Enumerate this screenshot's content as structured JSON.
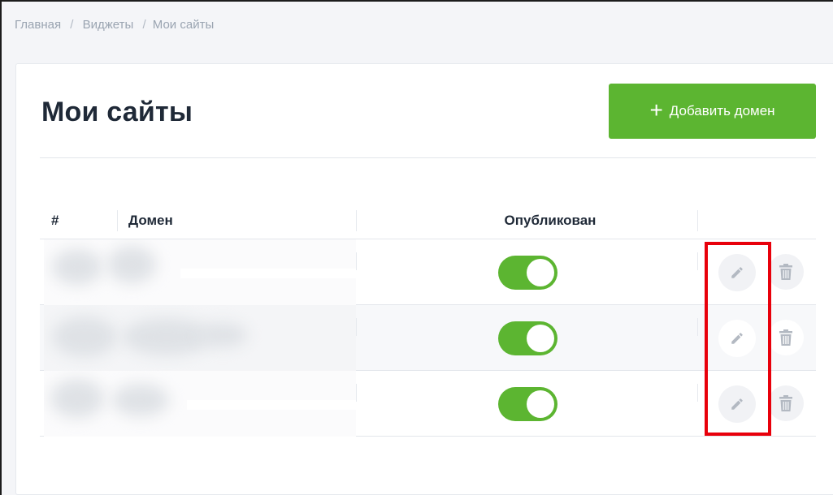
{
  "breadcrumb": {
    "home": "Главная",
    "widgets": "Виджеты",
    "current": "Мои сайты",
    "separator": "/"
  },
  "page": {
    "title": "Мои сайты",
    "add_button_label": "Добавить домен",
    "add_button_icon": "plus-icon"
  },
  "table": {
    "columns": [
      "#",
      "Домен",
      "Опубликован",
      ""
    ],
    "rows": [
      {
        "published": true,
        "edit_icon": "pencil-icon",
        "delete_icon": "trash-icon"
      },
      {
        "published": true,
        "edit_icon": "pencil-icon",
        "delete_icon": "trash-icon"
      },
      {
        "published": true,
        "edit_icon": "pencil-icon",
        "delete_icon": "trash-icon"
      }
    ]
  },
  "colors": {
    "accent_green": "#5cb531",
    "highlight_red": "#e8000b",
    "text_dark": "#1f2937",
    "breadcrumb_gray": "#9aa4b1"
  }
}
